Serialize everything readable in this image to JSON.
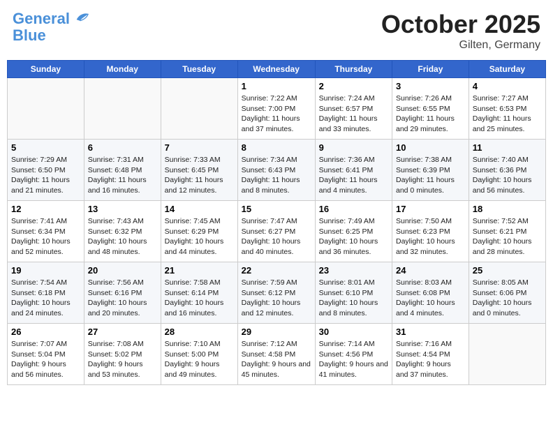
{
  "header": {
    "logo_line1": "General",
    "logo_line2": "Blue",
    "month": "October 2025",
    "location": "Gilten, Germany"
  },
  "weekdays": [
    "Sunday",
    "Monday",
    "Tuesday",
    "Wednesday",
    "Thursday",
    "Friday",
    "Saturday"
  ],
  "weeks": [
    [
      {
        "day": "",
        "info": ""
      },
      {
        "day": "",
        "info": ""
      },
      {
        "day": "",
        "info": ""
      },
      {
        "day": "1",
        "info": "Sunrise: 7:22 AM\nSunset: 7:00 PM\nDaylight: 11 hours\nand 37 minutes."
      },
      {
        "day": "2",
        "info": "Sunrise: 7:24 AM\nSunset: 6:57 PM\nDaylight: 11 hours\nand 33 minutes."
      },
      {
        "day": "3",
        "info": "Sunrise: 7:26 AM\nSunset: 6:55 PM\nDaylight: 11 hours\nand 29 minutes."
      },
      {
        "day": "4",
        "info": "Sunrise: 7:27 AM\nSunset: 6:53 PM\nDaylight: 11 hours\nand 25 minutes."
      }
    ],
    [
      {
        "day": "5",
        "info": "Sunrise: 7:29 AM\nSunset: 6:50 PM\nDaylight: 11 hours\nand 21 minutes."
      },
      {
        "day": "6",
        "info": "Sunrise: 7:31 AM\nSunset: 6:48 PM\nDaylight: 11 hours\nand 16 minutes."
      },
      {
        "day": "7",
        "info": "Sunrise: 7:33 AM\nSunset: 6:45 PM\nDaylight: 11 hours\nand 12 minutes."
      },
      {
        "day": "8",
        "info": "Sunrise: 7:34 AM\nSunset: 6:43 PM\nDaylight: 11 hours\nand 8 minutes."
      },
      {
        "day": "9",
        "info": "Sunrise: 7:36 AM\nSunset: 6:41 PM\nDaylight: 11 hours\nand 4 minutes."
      },
      {
        "day": "10",
        "info": "Sunrise: 7:38 AM\nSunset: 6:39 PM\nDaylight: 11 hours\nand 0 minutes."
      },
      {
        "day": "11",
        "info": "Sunrise: 7:40 AM\nSunset: 6:36 PM\nDaylight: 10 hours\nand 56 minutes."
      }
    ],
    [
      {
        "day": "12",
        "info": "Sunrise: 7:41 AM\nSunset: 6:34 PM\nDaylight: 10 hours\nand 52 minutes."
      },
      {
        "day": "13",
        "info": "Sunrise: 7:43 AM\nSunset: 6:32 PM\nDaylight: 10 hours\nand 48 minutes."
      },
      {
        "day": "14",
        "info": "Sunrise: 7:45 AM\nSunset: 6:29 PM\nDaylight: 10 hours\nand 44 minutes."
      },
      {
        "day": "15",
        "info": "Sunrise: 7:47 AM\nSunset: 6:27 PM\nDaylight: 10 hours\nand 40 minutes."
      },
      {
        "day": "16",
        "info": "Sunrise: 7:49 AM\nSunset: 6:25 PM\nDaylight: 10 hours\nand 36 minutes."
      },
      {
        "day": "17",
        "info": "Sunrise: 7:50 AM\nSunset: 6:23 PM\nDaylight: 10 hours\nand 32 minutes."
      },
      {
        "day": "18",
        "info": "Sunrise: 7:52 AM\nSunset: 6:21 PM\nDaylight: 10 hours\nand 28 minutes."
      }
    ],
    [
      {
        "day": "19",
        "info": "Sunrise: 7:54 AM\nSunset: 6:18 PM\nDaylight: 10 hours\nand 24 minutes."
      },
      {
        "day": "20",
        "info": "Sunrise: 7:56 AM\nSunset: 6:16 PM\nDaylight: 10 hours\nand 20 minutes."
      },
      {
        "day": "21",
        "info": "Sunrise: 7:58 AM\nSunset: 6:14 PM\nDaylight: 10 hours\nand 16 minutes."
      },
      {
        "day": "22",
        "info": "Sunrise: 7:59 AM\nSunset: 6:12 PM\nDaylight: 10 hours\nand 12 minutes."
      },
      {
        "day": "23",
        "info": "Sunrise: 8:01 AM\nSunset: 6:10 PM\nDaylight: 10 hours\nand 8 minutes."
      },
      {
        "day": "24",
        "info": "Sunrise: 8:03 AM\nSunset: 6:08 PM\nDaylight: 10 hours\nand 4 minutes."
      },
      {
        "day": "25",
        "info": "Sunrise: 8:05 AM\nSunset: 6:06 PM\nDaylight: 10 hours\nand 0 minutes."
      }
    ],
    [
      {
        "day": "26",
        "info": "Sunrise: 7:07 AM\nSunset: 5:04 PM\nDaylight: 9 hours\nand 56 minutes."
      },
      {
        "day": "27",
        "info": "Sunrise: 7:08 AM\nSunset: 5:02 PM\nDaylight: 9 hours\nand 53 minutes."
      },
      {
        "day": "28",
        "info": "Sunrise: 7:10 AM\nSunset: 5:00 PM\nDaylight: 9 hours\nand 49 minutes."
      },
      {
        "day": "29",
        "info": "Sunrise: 7:12 AM\nSunset: 4:58 PM\nDaylight: 9 hours\nand 45 minutes."
      },
      {
        "day": "30",
        "info": "Sunrise: 7:14 AM\nSunset: 4:56 PM\nDaylight: 9 hours\nand 41 minutes."
      },
      {
        "day": "31",
        "info": "Sunrise: 7:16 AM\nSunset: 4:54 PM\nDaylight: 9 hours\nand 37 minutes."
      },
      {
        "day": "",
        "info": ""
      }
    ]
  ]
}
